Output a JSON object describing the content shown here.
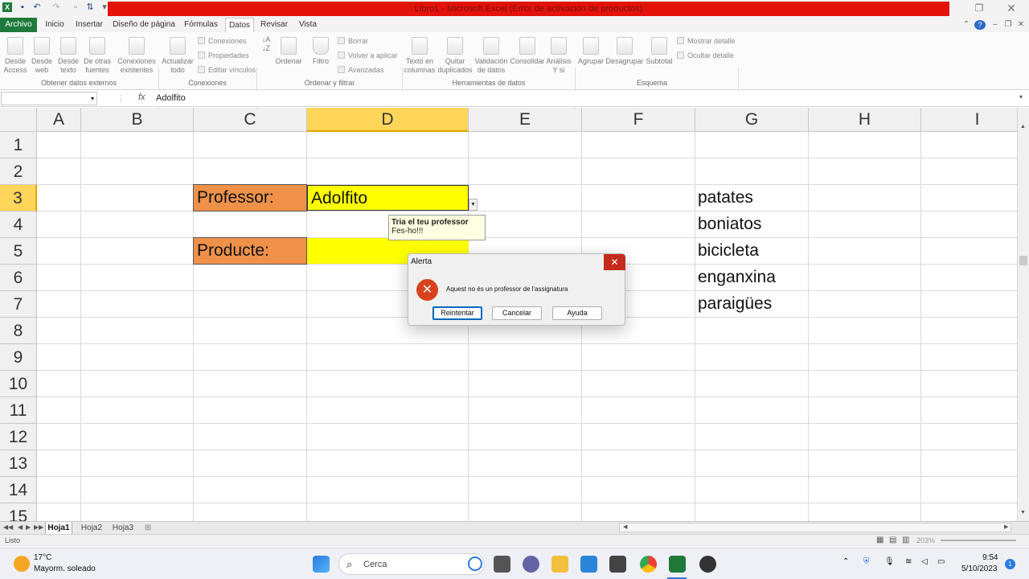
{
  "window": {
    "title": "Libro1 - Microsoft Excel (Error de activación de productos)"
  },
  "ribbon": {
    "tabs": [
      "Archivo",
      "Inicio",
      "Insertar",
      "Diseño de página",
      "Fórmulas",
      "Datos",
      "Revisar",
      "Vista"
    ],
    "active_tab": "Datos",
    "groups": {
      "external": {
        "label": "Obtener datos externos",
        "buttons": [
          {
            "l1": "Desde",
            "l2": "Access"
          },
          {
            "l1": "Desde",
            "l2": "web"
          },
          {
            "l1": "Desde",
            "l2": "texto"
          },
          {
            "l1": "De otras",
            "l2": "fuentes"
          },
          {
            "l1": "Conexiones",
            "l2": "existentes"
          }
        ]
      },
      "connections": {
        "label": "Conexiones",
        "refresh": {
          "l1": "Actualizar",
          "l2": "todo"
        },
        "small": [
          "Conexiones",
          "Propiedades",
          "Editar vínculos"
        ]
      },
      "sort": {
        "label": "Ordenar y filtrar",
        "sort_btn": "Ordenar",
        "filter_btn": "Filtro",
        "small": [
          "Borrar",
          "Volver a aplicar",
          "Avanzadas"
        ]
      },
      "tools": {
        "label": "Herramientas de datos",
        "buttons": [
          {
            "l1": "Texto en",
            "l2": "columnas"
          },
          {
            "l1": "Quitar",
            "l2": "duplicados"
          },
          {
            "l1": "Validación",
            "l2": "de datos"
          },
          {
            "l1": "Consolidar",
            "l2": ""
          },
          {
            "l1": "Análisis",
            "l2": "Y si"
          }
        ]
      },
      "outline": {
        "label": "Esquema",
        "buttons": [
          "Agrupar",
          "Desagrupar",
          "Subtotal"
        ],
        "small": [
          "Mostrar detalle",
          "Ocultar detalle"
        ]
      }
    }
  },
  "formula_bar": {
    "fx": "fx",
    "content": "Adolfito"
  },
  "sheet": {
    "columns": [
      "A",
      "B",
      "C",
      "D",
      "E",
      "F",
      "G",
      "H",
      "I"
    ],
    "selected_column": "D",
    "rows": [
      "1",
      "2",
      "3",
      "4",
      "5",
      "6",
      "7",
      "8",
      "9",
      "10",
      "11",
      "12",
      "13",
      "14",
      "15"
    ],
    "selected_row": "3",
    "cells": {
      "C3": "Professor:",
      "D3": "Adolfito",
      "C5": "Producte:",
      "G3": "patates",
      "G4": "boniatos",
      "G5": "bicicleta",
      "G6": "enganxina",
      "G7": "paraigües"
    }
  },
  "input_tooltip": {
    "title": "Tria el teu professor",
    "body": "Fes-ho!!!"
  },
  "dialog": {
    "title": "Alerta",
    "message": "Aquest no és un professor de l'assignatura",
    "buttons": [
      "Reintentar",
      "Cancelar",
      "Ayuda"
    ]
  },
  "sheet_tabs": [
    "Hoja1",
    "Hoja2",
    "Hoja3"
  ],
  "status": {
    "left": "Listo",
    "zoom": "203%"
  },
  "taskbar": {
    "weather_temp": "17°C",
    "weather_desc": "Mayorm. soleado",
    "search_placeholder": "Cerca",
    "time": "9:54",
    "date": "5/10/2023",
    "notifications": "1"
  },
  "colors": {
    "excel_green": "#1f7a3a",
    "title_red": "#e3120b",
    "label_orange": "#f0914a",
    "input_yellow": "#ffff00",
    "selection_gold": "#ffd65a",
    "error_red": "#d7421d"
  }
}
